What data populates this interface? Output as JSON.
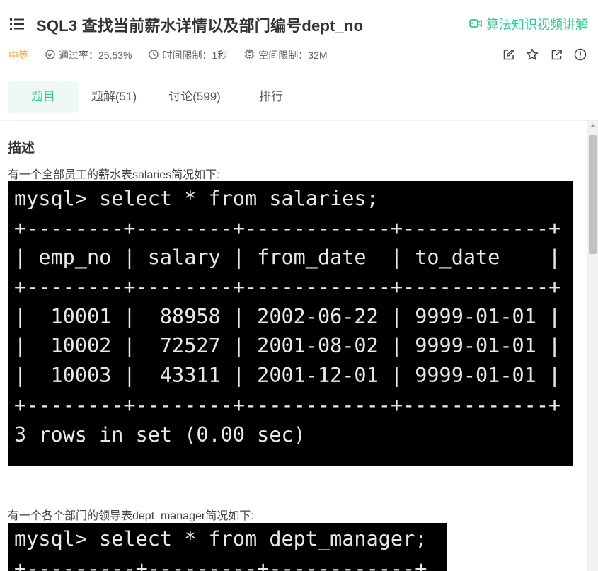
{
  "header": {
    "title": "SQL3  查找当前薪水详情以及部门编号dept_no",
    "video_label": "算法知识视频讲解",
    "difficulty": "中等",
    "pass_rate": "通过率：25.53%",
    "time_limit": "时间限制：1秒",
    "space_limit": "空间限制：32M"
  },
  "tabs": [
    {
      "label": "题目"
    },
    {
      "label": "题解(51)"
    },
    {
      "label": "讨论(599)"
    },
    {
      "label": "排行"
    }
  ],
  "content": {
    "section_title": "描述",
    "para1": "有一个全部员工的薪水表salaries简况如下:",
    "terminal1": [
      "mysql> select * from salaries;",
      "+--------+--------+------------+------------+",
      "| emp_no | salary | from_date  | to_date    |",
      "+--------+--------+------------+------------+",
      "|  10001 |  88958 | 2002-06-22 | 9999-01-01 |",
      "|  10002 |  72527 | 2001-08-02 | 9999-01-01 |",
      "|  10003 |  43311 | 2001-12-01 | 9999-01-01 |",
      "+--------+--------+------------+------------+",
      "3 rows in set (0.00 sec)"
    ],
    "para2": "有一个各个部门的领导表dept_manager简况如下:",
    "terminal2": [
      "mysql> select * from dept_manager;",
      "+---------+---------+------------+"
    ]
  },
  "colors": {
    "accent": "#32ca99",
    "difficulty": "#f5a623"
  },
  "icons": [
    "menu-icon",
    "video-icon",
    "check-circle-icon",
    "clock-icon",
    "chip-icon",
    "edit-icon",
    "star-icon",
    "share-icon",
    "alert-icon"
  ]
}
